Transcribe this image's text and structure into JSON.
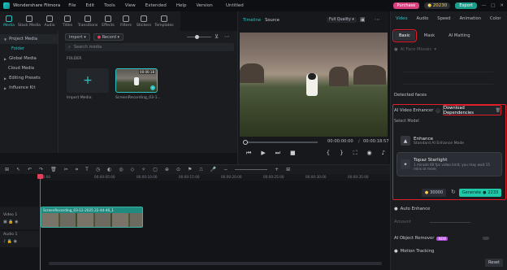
{
  "app": {
    "name": "Wondershare Filmora",
    "title": "Untitled",
    "menu": [
      "File",
      "Edit",
      "Tools",
      "View",
      "Extended",
      "Help",
      "Version"
    ],
    "purchase_label": "Purchase",
    "credits": "20230",
    "export_label": "Export"
  },
  "media_tabs": [
    "Media",
    "Stock Media",
    "Audio",
    "Titles",
    "Transitions",
    "Effects",
    "Filters",
    "Stickers",
    "Templates"
  ],
  "left_nav": {
    "project_media": "Project Media",
    "folder": "Folder",
    "global_media": "Global Media",
    "cloud_media": "Cloud Media",
    "editing_presets": "Editing Presets",
    "influence_kit": "Influence Kit"
  },
  "media": {
    "import_label": "Import",
    "record_label": "Record",
    "search_placeholder": "Search media",
    "folder_label": "FOLDER",
    "import_tile_label": "Import Media",
    "clip_tile_label": "ScreenRecording_03-1...",
    "clip_duration": "00:00:18"
  },
  "preview": {
    "tab_timeline": "Timeline",
    "tab_source": "Source",
    "quality": "Full Quality",
    "time_current": "00:00:00:00",
    "time_total": "00:00:18:57"
  },
  "right_panel": {
    "tabs": [
      "Video",
      "Audio",
      "Speed",
      "Animation",
      "Color"
    ],
    "subtabs": [
      "Basic",
      "Mask",
      "AI Matting"
    ],
    "ai_face_mosaic": "AI Face Mosaic",
    "detected_faces": "Detected faces",
    "ai_video_enhancer": "AI Video Enhancer",
    "download_deps": "Download Dependencies",
    "select_model": "Select Model",
    "model1_title": "Enhance",
    "model1_desc": "Standard AI Enhance Mode",
    "model2_title": "Topaz Starlight",
    "model2_desc": "1 minute 60 fps video limit; you may wait 15 mins or more",
    "credit_cost": "30000",
    "generate_label": "Generate",
    "generate_cost": "2233",
    "auto_enhance": "Auto Enhance",
    "amount": "Amount",
    "ai_object_remover": "AI Object Remover",
    "new_badge": "NEW",
    "motion_tracking": "Motion Tracking",
    "reset_label": "Reset"
  },
  "timeline": {
    "ruler": [
      "00:00",
      "00:00:05:00",
      "00:00:10:00",
      "00:00:15:00",
      "00:00:20:00",
      "00:00:25:00",
      "00:00:30:00",
      "00:00:35:00"
    ],
    "video_track": "Video 1",
    "audio_track": "Audio 1",
    "clip_name": "ScreenRecording_03-12-2025 22-44-46_1"
  }
}
